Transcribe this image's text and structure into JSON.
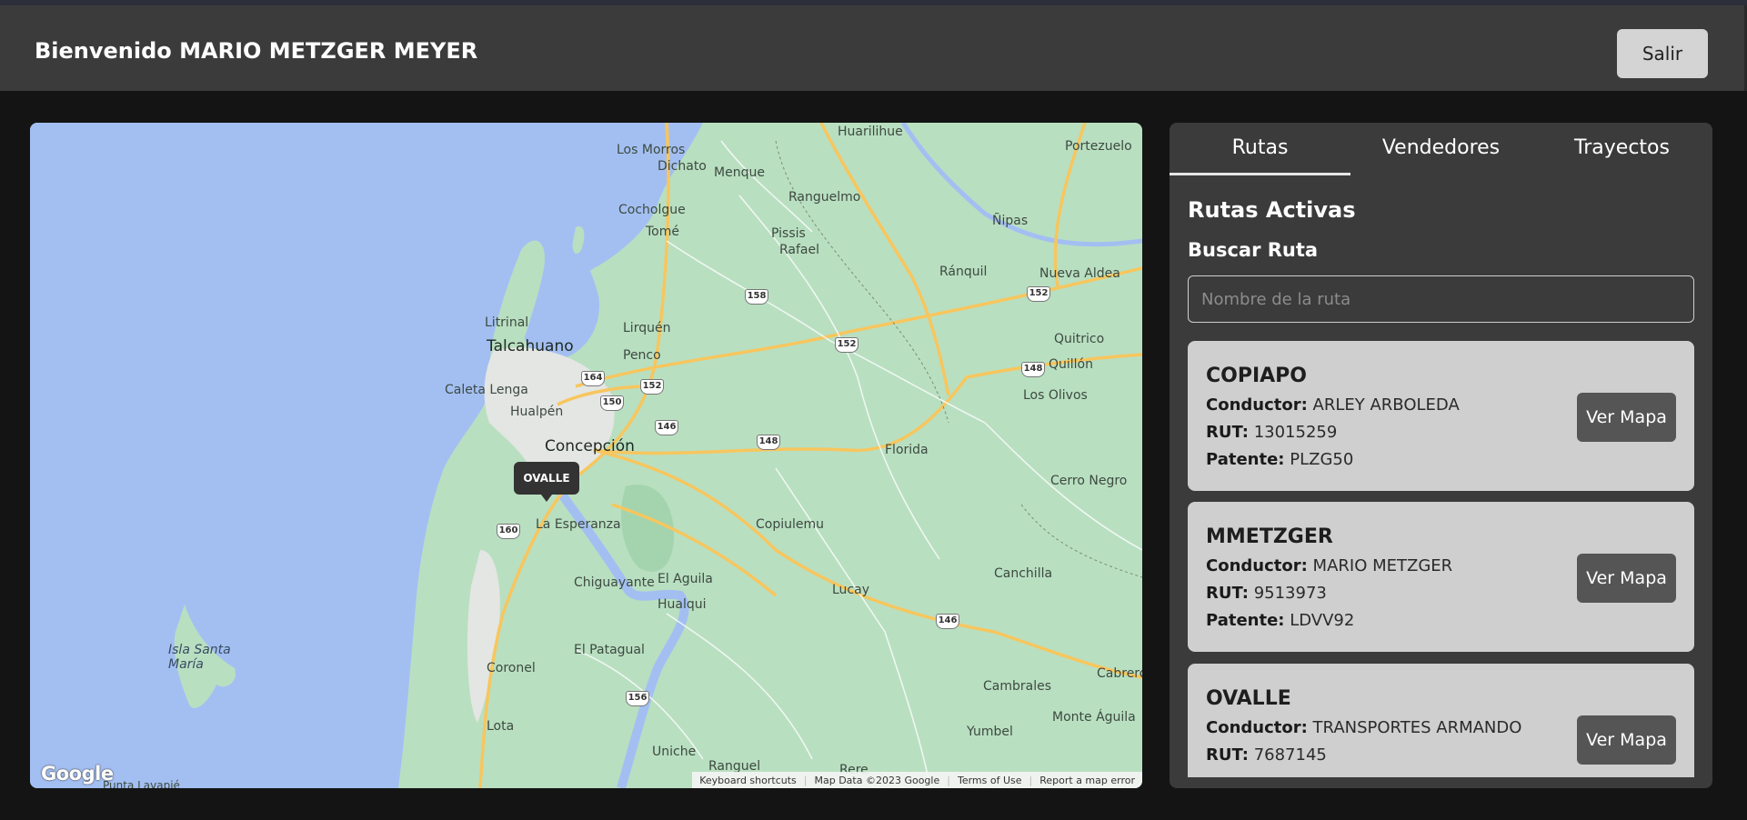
{
  "header": {
    "welcome_text": "Bienvenido MARIO METZGER MEYER",
    "logout_label": "Salir"
  },
  "map": {
    "marker_label": "OVALLE",
    "logo_text": "Google",
    "attribution": [
      "Keyboard shortcuts",
      "Map Data ©2023 Google",
      "Terms of Use",
      "Report a map error"
    ],
    "places": {
      "los_morros": "Los Morros",
      "dichato": "Dichato",
      "menque": "Menque",
      "huarilihue": "Huarilihue",
      "portezuelo": "Portezuelo",
      "cocholgue": "Cocholgue",
      "tome": "Tomé",
      "ranguelmo": "Ranguelmo",
      "pissis": "Pissis",
      "rafael": "Rafael",
      "nipas": "Ñipas",
      "ranquil": "Ránquil",
      "nueva_aldea": "Nueva Aldea",
      "litrinal": "Litrinal",
      "talcahuano": "Talcahuano",
      "lirquen": "Lirquén",
      "penco": "Penco",
      "quitrico": "Quitrico",
      "quillon": "Quillón",
      "caleta_lenga": "Caleta Lenga",
      "hualpen": "Hualpén",
      "los_olivos": "Los Olivos",
      "concepcion": "Concepción",
      "florida": "Florida",
      "cerro_negro": "Cerro Negro",
      "la_esperanza": "La Esperanza",
      "copiulemu": "Copiulemu",
      "canchilla": "Canchilla",
      "chiguayante": "Chiguayante",
      "el_aguila": "El Aguila",
      "hualqui": "Hualqui",
      "lucay": "Lucay",
      "isla_santa_maria": "Isla Santa María",
      "el_patagual": "El Patagual",
      "coronel": "Coronel",
      "cambrales": "Cambrales",
      "cabrero": "Cabrero",
      "monte_aguila": "Monte Águila",
      "yumbel": "Yumbel",
      "lota": "Lota",
      "uniche": "Uniche",
      "ranguel": "Ranguel",
      "rere": "Rere",
      "punta_lavapie": "Punta Lavapié"
    },
    "routes": {
      "r158": "158",
      "r164": "164",
      "r150": "150",
      "r152a": "152",
      "r152b": "152",
      "r152c": "152",
      "r146a": "146",
      "r148a": "148",
      "r148b": "148",
      "r146b": "146",
      "r160": "160",
      "r156": "156"
    }
  },
  "panel": {
    "tabs": [
      {
        "label": "Rutas"
      },
      {
        "label": "Vendedores"
      },
      {
        "label": "Trayectos"
      }
    ],
    "title": "Rutas Activas",
    "search_label": "Buscar Ruta",
    "search_placeholder": "Nombre de la ruta",
    "search_value": "",
    "field_labels": {
      "driver": "Conductor:",
      "rut": "RUT:",
      "plate": "Patente:"
    },
    "view_map_label": "Ver Mapa",
    "routes": [
      {
        "name": "COPIAPO",
        "driver": "ARLEY ARBOLEDA",
        "rut": "13015259",
        "plate": "PLZG50"
      },
      {
        "name": "MMETZGER",
        "driver": "MARIO METZGER",
        "rut": "9513973",
        "plate": "LDVV92"
      },
      {
        "name": "OVALLE",
        "driver": "TRANSPORTES ARMANDO",
        "rut": "7687145",
        "plate": ""
      }
    ]
  },
  "colors": {
    "header_bg": "#3b3b3b",
    "page_bg": "#141414",
    "card_bg": "#cfcfcf",
    "button_dark": "#555555",
    "map_land": "#b9dfc1",
    "map_water": "#a3bff2",
    "map_roads": "#f7c65e"
  }
}
